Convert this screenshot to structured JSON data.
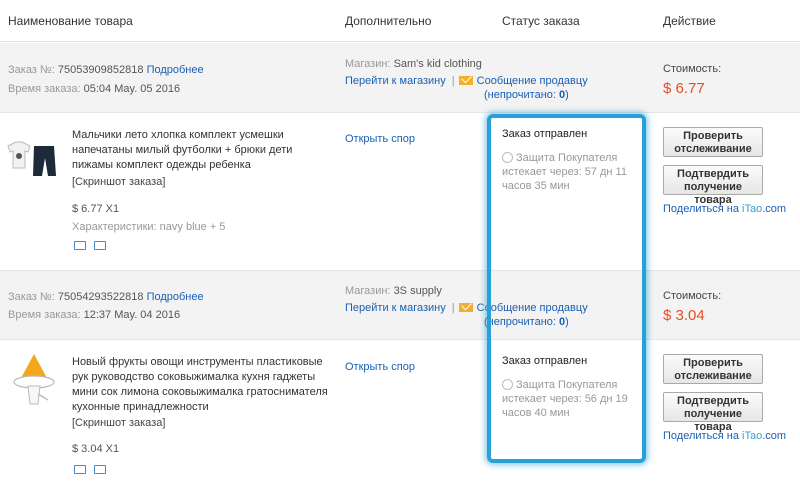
{
  "header": {
    "col_product": "Наименование товара",
    "col_extra": "Дополнительно",
    "col_status": "Статус заказа",
    "col_action": "Действие"
  },
  "orders": [
    {
      "order_label": "Заказ №:",
      "order_no": "75053909852818",
      "details_link": "Подробнее",
      "time_label": "Время заказа:",
      "time_value": "05:04 May. 05 2016",
      "shop_label": "Магазин:",
      "shop_name": "Sam's kid clothing",
      "go_shop": "Перейти к магазину",
      "msg_seller": "Сообщение продавцу",
      "unread_prefix": "(непрочитано: ",
      "unread_count": "0",
      "unread_suffix": ")",
      "cost_label": "Стоимость:",
      "cost_value": "$ 6.77",
      "product_title": "Мальчики лето хлопка комплект усмешки напечатаны милый футболки + брюки дети пижамы комплект одежды ребенка",
      "screenshot": "[Скриншот заказа]",
      "price_qty": "$ 6.77 X1",
      "specs": "Характеристики: navy blue + 5",
      "dispute": "Открыть спор",
      "status": "Заказ отправлен",
      "protect_1": "Защита Покупателя",
      "protect_2": "истекает через: 57 дн 11",
      "protect_3": "часов 35 мин",
      "btn_track": [
        "Проверить",
        "отслеживание"
      ],
      "btn_confirm": [
        "Подтвердить",
        "получение товара"
      ],
      "share_prefix": "Поделиться на ",
      "share_brand": "iTao",
      "share_suffix": ".com"
    },
    {
      "order_label": "Заказ №:",
      "order_no": "75054293522818",
      "details_link": "Подробнее",
      "time_label": "Время заказа:",
      "time_value": "12:37 May. 04 2016",
      "shop_label": "Магазин:",
      "shop_name": "3S supply",
      "go_shop": "Перейти к магазину",
      "msg_seller": "Сообщение продавцу",
      "unread_prefix": "(непрочитано: ",
      "unread_count": "0",
      "unread_suffix": ")",
      "cost_label": "Стоимость:",
      "cost_value": "$ 3.04",
      "product_title": "Новый фрукты овощи инструменты пластиковые рук руководство соковыжималка кухня гаджеты мини сок лимона соковыжималка гратоснимателя кухонные принадлежности",
      "screenshot": "[Скриншот заказа]",
      "price_qty": "$ 3.04 X1",
      "dispute": "Открыть спор",
      "status": "Заказ отправлен",
      "protect_1": "Защита Покупателя",
      "protect_2": "истекает через: 56 дн 19",
      "protect_3": "часов 40 мин",
      "btn_track": [
        "Проверить",
        "отслеживание"
      ],
      "btn_confirm": [
        "Подтвердить",
        "получение товара"
      ],
      "share_prefix": "Поделиться на ",
      "share_brand": "iTao",
      "share_suffix": ".com"
    }
  ],
  "colors": {
    "link": "#1a5fb4",
    "price": "#e0502a",
    "highlight": "#2aa0d8",
    "band": "#f3f3f3"
  }
}
